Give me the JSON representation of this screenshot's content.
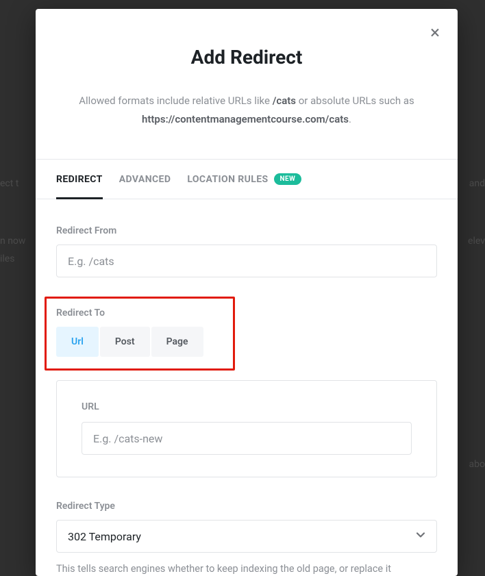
{
  "background": {
    "t1": "ect t",
    "t2": "and",
    "t3": "n now",
    "t4": "iles",
    "t5": "elev",
    "t6": "abo"
  },
  "modal": {
    "close_label": "×",
    "title": "Add Redirect",
    "desc_prefix": "Allowed formats include relative URLs like ",
    "desc_bold1": "/cats",
    "desc_mid": " or absolute URLs such as ",
    "desc_bold2": "https://contentmanagementcourse.com/cats",
    "desc_suffix": "."
  },
  "tabs": {
    "redirect": "REDIRECT",
    "advanced": "ADVANCED",
    "location": "LOCATION RULES",
    "badge": "NEW"
  },
  "form": {
    "from_label": "Redirect From",
    "from_placeholder": "E.g. /cats",
    "to_label": "Redirect To",
    "seg": {
      "url": "Url",
      "post": "Post",
      "page": "Page"
    },
    "url_label": "URL",
    "url_placeholder": "E.g. /cats-new",
    "type_label": "Redirect Type",
    "type_value": "302 Temporary",
    "type_helper": "This tells search engines whether to keep indexing the old page, or replace it"
  }
}
